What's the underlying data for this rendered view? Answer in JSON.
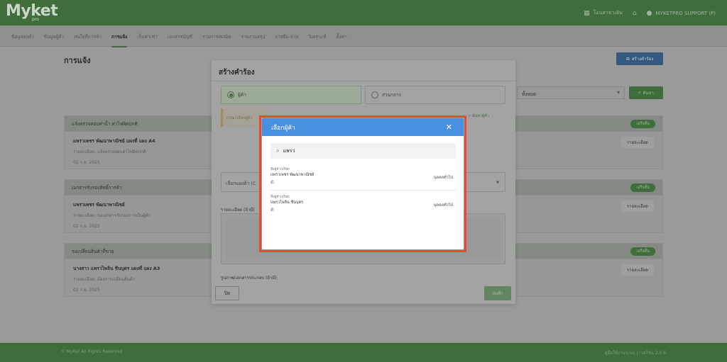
{
  "header": {
    "brand": "Myket",
    "brand_sub": "pro",
    "user_link": "โอนสาขาเดิม",
    "user_name": "MYKETPRO SUPPORT (P)"
  },
  "nav": {
    "items": [
      "ข้อมูลลงคำ",
      "ข้อมูลผู้ค้า",
      "สนใจที่การค้า",
      "การแจ้ง",
      "เก็บค่าเช่า",
      "เอกสารบัญชี",
      "รายการสมณิต",
      "รายงานสรุป",
      "การยืม-จ่าย",
      "วิเคราะห์",
      "ตั้งค่า"
    ],
    "active_index": 3
  },
  "page": {
    "title": "การแจ้ง",
    "create_label": "สร้างคำร้อง",
    "filter_value": "ทั้งหมด",
    "search_label": "ค้นหา"
  },
  "cards": [
    {
      "head": "แจ้งตรวจสอบค่าน้ำ ค่าไฟผิดปกติ",
      "badge": "เสร็จสิ้น",
      "who": "แพรวเพชร พัฒนาพาณิชย์ แผงที่ แผง A4",
      "desc": "รายละเอียด: แจ้งตรวจสอบค่าไฟผิดปกติ",
      "date": "02 ก.ย. 2025",
      "details": "รายละเอียด"
    },
    {
      "head": "เอกสารรับรองสิทธิ์การค้า",
      "badge": "เสร็จสิ้น",
      "who": "แพรวเพชร พัฒนาพาณิชย์",
      "desc": "รายละเอียด: ขอเอกสารรับรองการเป็นผู้ค้า",
      "date": "02 ก.ย. 2025",
      "details": "รายละเอียด"
    },
    {
      "head": "ขอเปลี่ยนสินค้าที่ขาย",
      "badge": "เสร็จสิ้น",
      "who": "นางสาว แพรวไพลิน ชินบุตร แผงที่ แผง A3",
      "desc": "รายละเอียด: ต้องการเปลี่ยนสินค้า",
      "date": "02 ก.ย. 2025",
      "details": "รายละเอียด"
    }
  ],
  "footer": {
    "left": "© MyKet All Rights Reserved",
    "right": "คู่มือใช้งานระบบ | เวอร์ชัน 2.0.6"
  },
  "request_modal": {
    "title": "สร้างคำร้อง",
    "radio_vendor": "ผู้ค้า",
    "radio_central": "ส่วนกลาง",
    "alert": "กรุณาเลือกผู้ค้า",
    "find_vendor": "ค้นหาผู้ค้า",
    "stall_placeholder": "เลือกแผงค้า (C",
    "detail_label": "รายละเอียด (ถ้ามี)",
    "attach_label": "รูปภาพ/เอกสารประกอบ (ถ้ามี)",
    "close": "ปิด",
    "save": "บันทึก"
  },
  "vendor_picker": {
    "title": "เลือกผู้ค้า",
    "search_value": "แพรว",
    "results": [
      {
        "caption": "ชื่อผู้ค้า/บริษัท",
        "name": "แพรวเพชร พัฒนาพาณิชย์",
        "type": "บุคคลทั่วไป"
      },
      {
        "caption": "ชื่อผู้ค้า/บริษัท",
        "name": "แพรวไพลิน ชินบุตร",
        "type": "บุคคลทั่วไป"
      }
    ]
  },
  "colors": {
    "brand_green": "#3f6e3c",
    "dialog_blue": "#4a90e2",
    "highlight_red": "#e8492f"
  }
}
